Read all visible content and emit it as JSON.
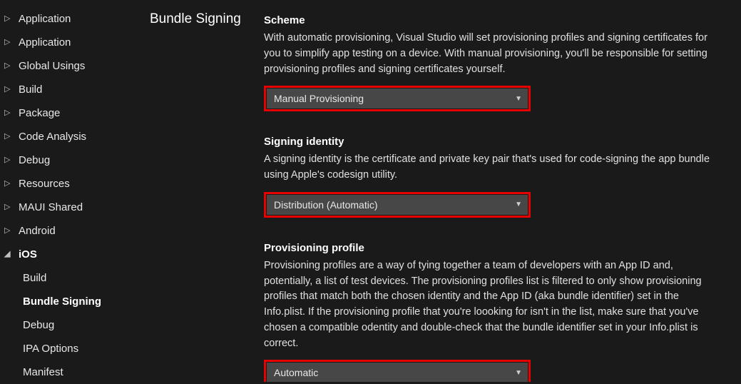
{
  "sidebar": {
    "items": [
      {
        "label": "Application",
        "expanded": false,
        "sub": false
      },
      {
        "label": "Application",
        "expanded": false,
        "sub": false
      },
      {
        "label": "Global Usings",
        "expanded": false,
        "sub": false
      },
      {
        "label": "Build",
        "expanded": false,
        "sub": false
      },
      {
        "label": "Package",
        "expanded": false,
        "sub": false
      },
      {
        "label": "Code Analysis",
        "expanded": false,
        "sub": false
      },
      {
        "label": "Debug",
        "expanded": false,
        "sub": false
      },
      {
        "label": "Resources",
        "expanded": false,
        "sub": false
      },
      {
        "label": "MAUI Shared",
        "expanded": false,
        "sub": false
      },
      {
        "label": "Android",
        "expanded": false,
        "sub": false
      },
      {
        "label": "iOS",
        "expanded": true,
        "sub": false
      },
      {
        "label": "Build",
        "sub": true
      },
      {
        "label": "Bundle Signing",
        "sub": true,
        "selected": true
      },
      {
        "label": "Debug",
        "sub": true
      },
      {
        "label": "IPA Options",
        "sub": true
      },
      {
        "label": "Manifest",
        "sub": true
      }
    ]
  },
  "page_title": "Bundle Signing",
  "sections": {
    "scheme": {
      "heading": "Scheme",
      "description": "With automatic provisioning, Visual Studio will set provisioning profiles and signing certificates for you to simplify app testing on a device. With manual provisioning, you'll be responsible for setting provisioning profiles and signing certificates yourself.",
      "value": "Manual Provisioning"
    },
    "signing_identity": {
      "heading": "Signing identity",
      "description": "A signing identity is the certificate and private key pair that's used for code-signing the app bundle using Apple's codesign utility.",
      "value": "Distribution (Automatic)"
    },
    "provisioning_profile": {
      "heading": "Provisioning profile",
      "description": "Provisioning profiles are a way of tying together a team of developers with an App ID and, potentially, a list of test devices. The provisioning profiles list is filtered to only show provisioning profiles that match both the chosen identity and the App ID (aka bundle identifier) set in the Info.plist. If the provisioning profile that you're loooking for isn't in the list, make sure that you've chosen a compatible odentity and double-check that the bundle identifier set in your Info.plist is correct.",
      "value": "Automatic"
    }
  },
  "highlight_color": "#e60000"
}
